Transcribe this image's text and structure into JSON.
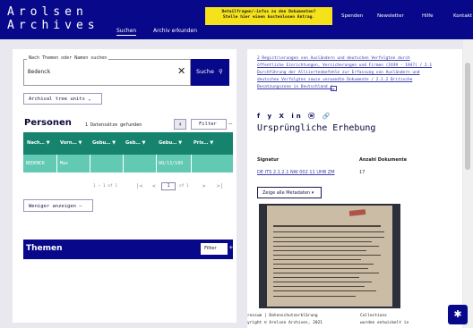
{
  "header": {
    "logo_line1": "Arolsen",
    "logo_line2": "Archives",
    "tabs": [
      "Suchen",
      "Archiv erkunden"
    ],
    "notice_line1": "Detailfragen/-infos zu den Dokumenten?",
    "notice_line2": "Stelle hier einen kostenlosen Antrag.",
    "nav": [
      "Spenden",
      "Newsletter",
      "Hilfe",
      "Kontakt"
    ]
  },
  "search": {
    "legend": "Nach Themen oder Namen suchen",
    "value": "Bedenck",
    "clear_icon": "close-icon",
    "button_label": "Suche",
    "button_icon": "search-icon"
  },
  "tree_button": "Archival tree units",
  "persons": {
    "title": "Personen",
    "count": "1 Datensätze gefunden",
    "filter_label": "Filter",
    "columns": [
      "Nach…",
      "Vorn…",
      "Gebu…",
      "Geb…",
      "Gebu…",
      "Pris…"
    ],
    "rows": [
      [
        "BEDENCK",
        "Max",
        "",
        "",
        "08/13/189",
        ""
      ]
    ],
    "pager_count": "1 – 1 of 1",
    "pager_page": "1",
    "pager_of": "of 1",
    "less_button": "Weniger anzeigen"
  },
  "themen": {
    "title": "Themen",
    "filter_label": "Filter"
  },
  "detail": {
    "breadcrumb": [
      "2 Registrierungen von Ausländern und deutschen Verfolgten durch",
      "öffentliche Einrichtungen, Versicherungen und Firmen (1939 - 1947) / 2.1",
      "Durchführung der Alliiertenbefehle zur Erfassung von Ausländern und",
      "deutschen Verfolgten sowie verwandte Dokumente / 2.1.2 Britische",
      "Besatzungszone in Deutschland /"
    ],
    "share_icons": "f y X in ⓦ 🔗",
    "title": "Ursprüngliche Erhebung",
    "signatur_label": "Signatur",
    "signatur_value": "DE ITS 2.1.2.1 NW 002 11 UHB ZM",
    "anzahl_label": "Anzahl Dokumente",
    "anzahl_value": "17",
    "metadata_button": "Zeige alle Metadaten"
  },
  "footer": {
    "left1": "ressum  |  Datenschutzerklärung",
    "left2": "yright © Arolsen Archives, 2021",
    "right1": "Collections",
    "right2": "wurden entwickelt in"
  }
}
